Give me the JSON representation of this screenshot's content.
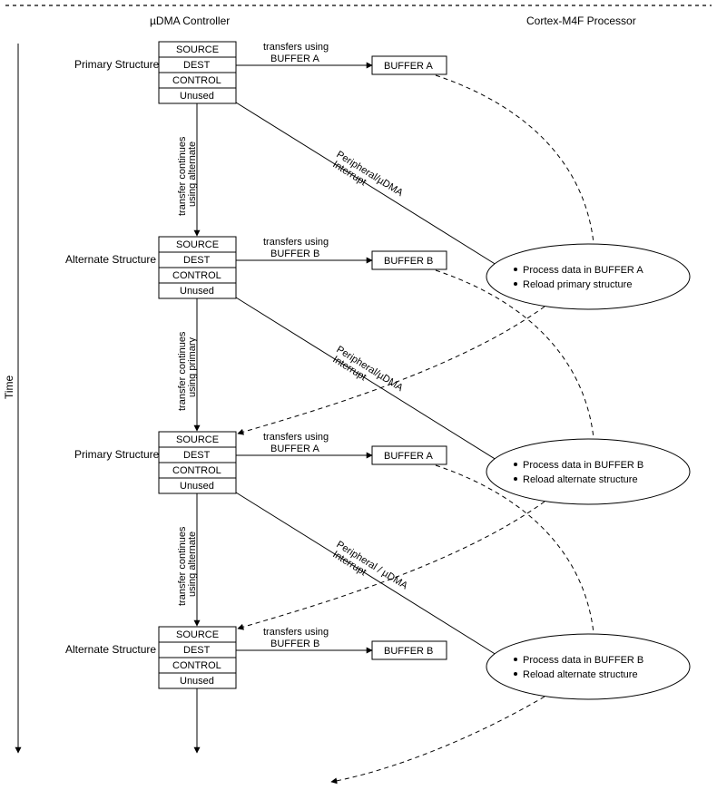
{
  "header": {
    "dma": "µDMA Controller",
    "cpu": "Cortex-M4F Processor"
  },
  "timeAxis": "Time",
  "structRows": [
    "SOURCE",
    "DEST",
    "CONTROL",
    "Unused"
  ],
  "structLabels": {
    "primary": "Primary Structure",
    "alternate": "Alternate Structure"
  },
  "transfers": {
    "a": {
      "l1": "transfers using",
      "l2": "BUFFER A"
    },
    "b": {
      "l1": "transfers using",
      "l2": "BUFFER B"
    }
  },
  "buffers": {
    "a": "BUFFER A",
    "b": "BUFFER B"
  },
  "continues": {
    "alt": {
      "l1": "transfer continues",
      "l2": "using alternate"
    },
    "pri": {
      "l1": "transfer continues",
      "l2": "using primary"
    }
  },
  "interrupt": {
    "l1": "Peripheral/µDMA",
    "l1b": "Peripheral / µDMA",
    "l2": "Interrupt"
  },
  "process": {
    "a": {
      "l1": "Process data in BUFFER A",
      "l2": "Reload primary structure"
    },
    "b": {
      "l1": "Process data in BUFFER B",
      "l2": "Reload alternate structure"
    }
  }
}
